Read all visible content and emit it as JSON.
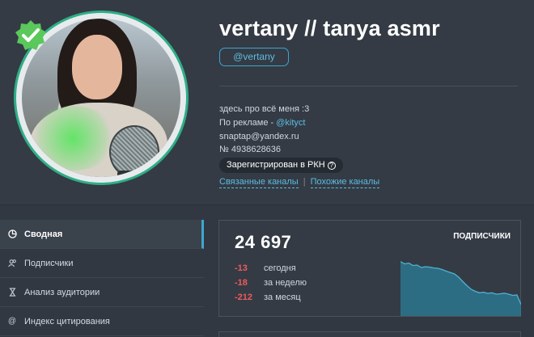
{
  "channel": {
    "title": "vertany // tanya asmr",
    "handle": "@vertany",
    "description": {
      "line1": "здесь про всё меня :3",
      "ads_prefix": "По рекламе - ",
      "ads_contact": "@kityct",
      "email": "snaptap@yandex.ru",
      "number": "№ 4938628636"
    },
    "rkn_badge": "Зарегистрирован в РКН",
    "links": {
      "related": "Связанные каналы",
      "separator": "|",
      "similar": "Похожие каналы"
    }
  },
  "icons": {
    "verified": "verified-badge-icon",
    "rkn_help": "question-icon"
  },
  "colors": {
    "accent": "#3fa6cf",
    "negative": "#ef5a5a",
    "verified": "#5ac85a",
    "chart_fill": "#2b7f98"
  },
  "sidebar": {
    "items": [
      {
        "label": "Сводная",
        "icon": "pie-chart-icon",
        "active": true
      },
      {
        "label": "Подписчики",
        "icon": "users-icon",
        "active": false
      },
      {
        "label": "Анализ аудитории",
        "icon": "hourglass-icon",
        "active": false
      },
      {
        "label": "Индекс цитирования",
        "icon": "at-icon",
        "active": false
      }
    ]
  },
  "subscribers": {
    "count": "24 697",
    "label": "ПОДПИСЧИКИ",
    "deltas": [
      {
        "value": "-13",
        "label": "сегодня"
      },
      {
        "value": "-18",
        "label": "за неделю"
      },
      {
        "value": "-212",
        "label": "за месяц"
      }
    ]
  },
  "chart_data": {
    "type": "area",
    "title": "",
    "xlabel": "",
    "ylabel": "",
    "x": [
      0,
      1,
      2,
      3,
      4,
      5,
      6,
      7,
      8,
      9,
      10,
      11,
      12,
      13,
      14,
      15,
      16,
      17,
      18,
      19,
      20,
      21,
      22,
      23,
      24,
      25,
      26,
      27,
      28,
      29
    ],
    "series": [
      {
        "values": [
          24909,
          24898,
          24902,
          24890,
          24892,
          24880,
          24884,
          24882,
          24878,
          24876,
          24870,
          24862,
          24855,
          24848,
          24832,
          24810,
          24790,
          24772,
          24762,
          24755,
          24758,
          24752,
          24755,
          24748,
          24750,
          24753,
          24748,
          24742,
          24744,
          24697
        ]
      }
    ],
    "ylim": [
      24640,
      24920
    ],
    "grid": false
  }
}
